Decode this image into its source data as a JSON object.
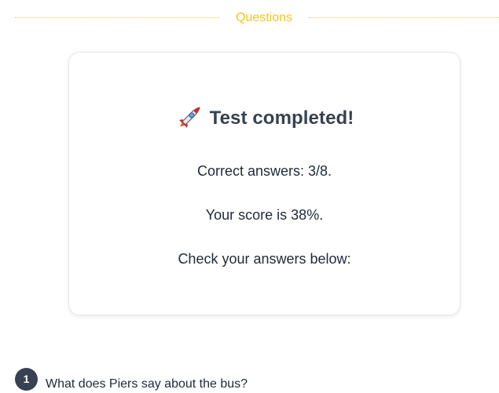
{
  "section": {
    "title": "Questions"
  },
  "result": {
    "title": "Test completed!",
    "correct_answers": "Correct answers: 3/8.",
    "score": "Your score is 38%.",
    "check": "Check your answers below:"
  },
  "questions": [
    {
      "number": "1",
      "text": "What does Piers say about the bus?"
    }
  ],
  "colors": {
    "accent": "#f5c518",
    "badge": "#374151"
  },
  "icons": {
    "title_icon": "rocket-icon"
  }
}
